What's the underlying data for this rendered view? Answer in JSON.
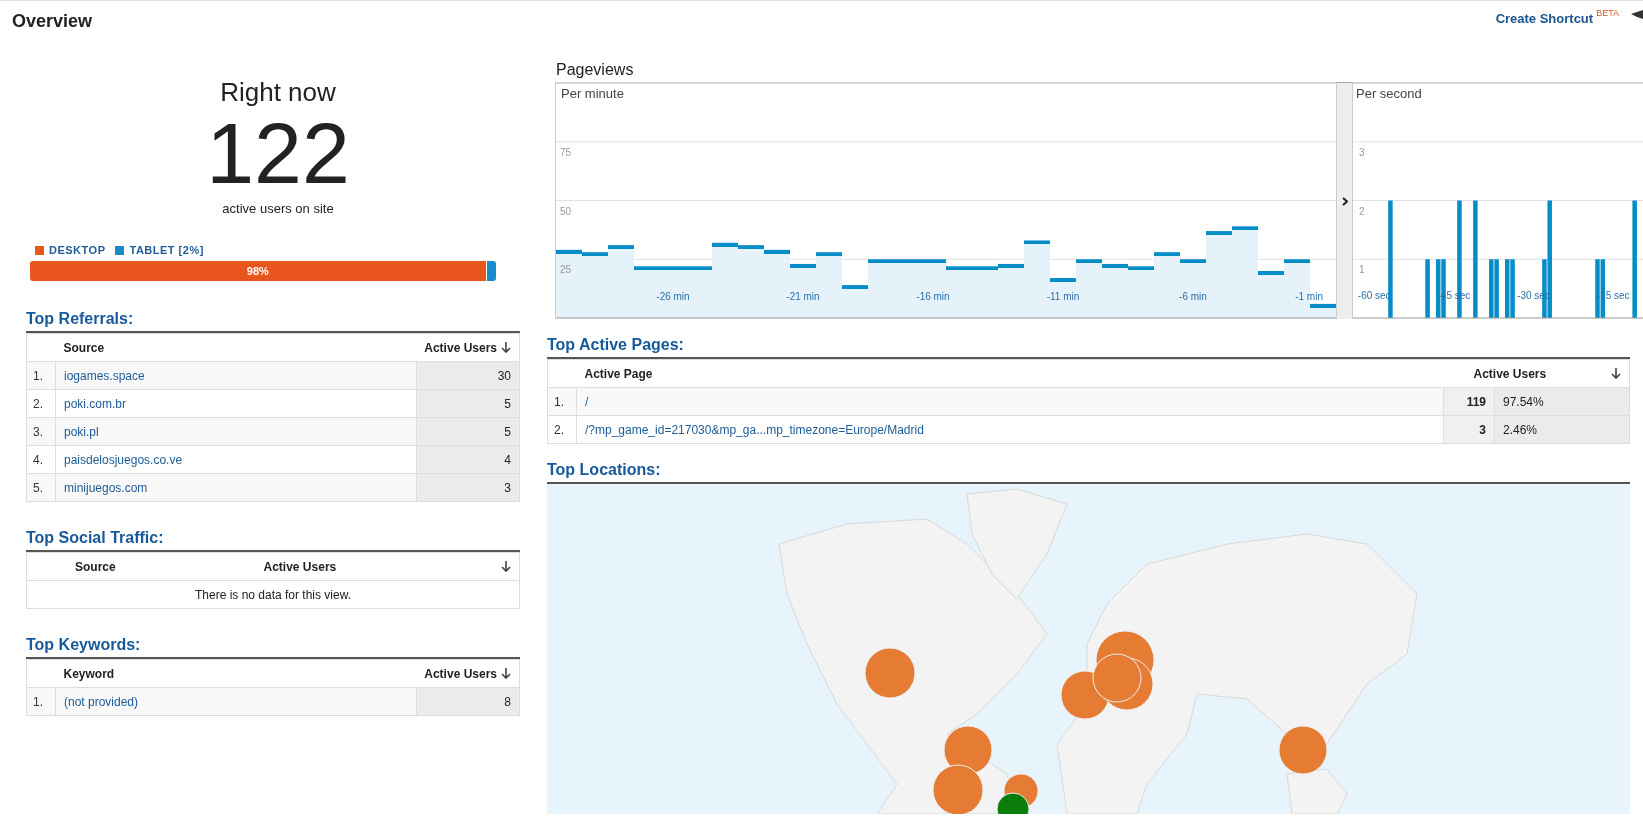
{
  "header": {
    "title": "Overview",
    "shortcut_link": "Create Shortcut",
    "shortcut_badge": "BETA"
  },
  "right_now": {
    "heading": "Right now",
    "count": "122",
    "caption": "active users on site",
    "devices": [
      {
        "label": "DESKTOP",
        "color": "#e8561e",
        "level": 0.98,
        "bar_label": "98%"
      },
      {
        "label": "TABLET [2%]",
        "color": "#1a8bc9",
        "level": 0.02
      }
    ]
  },
  "pageviews": {
    "title": "Pageviews",
    "per_minute": {
      "label": "Per minute",
      "chart_data": {
        "type": "bar",
        "x": [
          -30,
          -29,
          -28,
          -27,
          -26,
          -25,
          -24,
          -23,
          -22,
          -21,
          -20,
          -19,
          -18,
          -17,
          -16,
          -15,
          -14,
          -13,
          -12,
          -11,
          -10,
          -9,
          -8,
          -7,
          -6,
          -5,
          -4,
          -3,
          -2,
          -1
        ],
        "values": [
          29,
          28,
          31,
          22,
          22,
          22,
          32,
          31,
          29,
          23,
          28,
          14,
          25,
          25,
          25,
          22,
          22,
          23,
          33,
          17,
          25,
          23,
          22,
          28,
          25,
          37,
          39,
          20,
          25,
          6
        ],
        "xlim": [
          -30.5,
          -0.5
        ],
        "ylim": [
          0,
          100
        ],
        "grid": true,
        "yticks": [
          25,
          50,
          75
        ],
        "xticks": [
          {
            "value": -26,
            "label": "-26 min"
          },
          {
            "value": -21,
            "label": "-21 min"
          },
          {
            "value": -16,
            "label": "-16 min"
          },
          {
            "value": -11,
            "label": "-11 min"
          },
          {
            "value": -6,
            "label": "-6 min"
          },
          {
            "value": -1,
            "label": "-1 min"
          }
        ]
      }
    },
    "per_second": {
      "label": "Per second",
      "chart_data": {
        "type": "bar",
        "x": [
          -60,
          -59,
          -58,
          -57,
          -56,
          -55,
          -54,
          -53,
          -52,
          -51,
          -50,
          -49,
          -48,
          -47,
          -46,
          -45,
          -44,
          -43,
          -42,
          -41,
          -40,
          -39,
          -38,
          -37,
          -36,
          -35,
          -34,
          -33,
          -32,
          -31,
          -30,
          -29,
          -28,
          -27,
          -26,
          -25,
          -24,
          -23,
          -22,
          -21,
          -20,
          -19,
          -18,
          -17,
          -16,
          -15,
          -14,
          -13,
          -12,
          -11,
          -10
        ],
        "values": [
          0,
          0,
          0,
          2,
          0,
          0,
          0,
          0,
          0,
          0,
          1,
          0,
          1,
          1,
          0,
          0,
          2,
          0,
          0,
          2,
          0,
          0,
          1,
          1,
          0,
          1,
          1,
          0,
          0,
          0,
          0,
          0,
          1,
          2,
          0,
          0,
          0,
          0,
          0,
          0,
          0,
          0,
          1,
          1,
          0,
          0,
          0,
          0,
          0,
          2,
          0
        ],
        "xlim": [
          -64,
          -7.5
        ],
        "ylim": [
          0,
          4
        ],
        "grid": true,
        "yticks": [
          1,
          2,
          3
        ],
        "xticks": [
          {
            "value": -60,
            "label": "-60 sec"
          },
          {
            "value": -45,
            "label": "-45 sec"
          },
          {
            "value": -30,
            "label": "-30 sec"
          },
          {
            "value": -15,
            "label": "-15 sec"
          }
        ]
      }
    }
  },
  "top_referrals": {
    "title": "Top Referrals:",
    "columns": [
      "Source",
      "Active Users"
    ],
    "rows": [
      {
        "rank": "1.",
        "source": "iogames.space",
        "active_users": "30"
      },
      {
        "rank": "2.",
        "source": "poki.com.br",
        "active_users": "5"
      },
      {
        "rank": "3.",
        "source": "poki.pl",
        "active_users": "5"
      },
      {
        "rank": "4.",
        "source": "paisdelosjuegos.co.ve",
        "active_users": "4"
      },
      {
        "rank": "5.",
        "source": "minijuegos.com",
        "active_users": "3"
      }
    ]
  },
  "top_social_traffic": {
    "title": "Top Social Traffic:",
    "columns": [
      "Source",
      "Active Users"
    ],
    "empty_message": "There is no data for this view."
  },
  "top_keywords": {
    "title": "Top Keywords:",
    "columns": [
      "Keyword",
      "Active Users"
    ],
    "rows": [
      {
        "rank": "1.",
        "keyword": "(not provided)",
        "active_users": "8"
      }
    ]
  },
  "top_active_pages": {
    "title": "Top Active Pages:",
    "columns": [
      "Active Page",
      "Active Users"
    ],
    "rows": [
      {
        "rank": "1.",
        "page": "/",
        "active_users": "119",
        "percent": "97.54%"
      },
      {
        "rank": "2.",
        "page": "/?mp_game_id=217030&mp_ga...mp_timezone=Europe/Madrid",
        "active_users": "3",
        "percent": "2.46%"
      }
    ]
  },
  "top_locations": {
    "title": "Top Locations:"
  }
}
